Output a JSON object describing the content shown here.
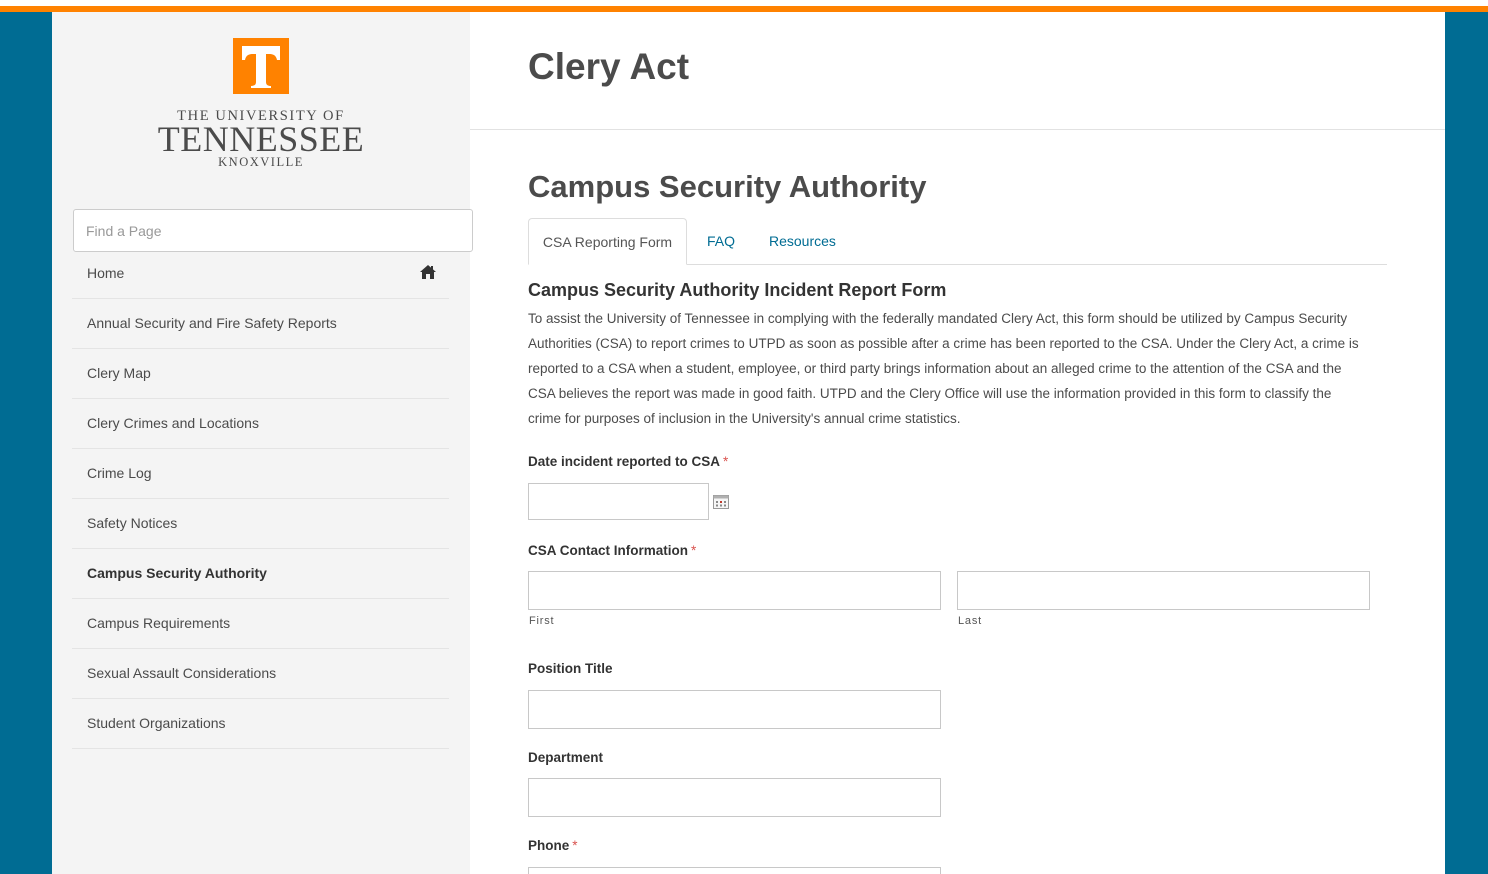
{
  "brand": {
    "logo_letter": "T",
    "line1": "THE UNIVERSITY OF",
    "line2": "TENNESSEE",
    "line3": "KNOXVILLE",
    "orange": "#ff8200",
    "blue": "#006c93"
  },
  "sidebar": {
    "search_placeholder": "Find a Page",
    "items": [
      {
        "label": "Home",
        "icon": "home-icon"
      },
      {
        "label": "Annual Security and Fire Safety Reports"
      },
      {
        "label": "Clery Map"
      },
      {
        "label": "Clery Crimes and Locations"
      },
      {
        "label": "Crime Log"
      },
      {
        "label": "Safety Notices"
      },
      {
        "label": "Campus Security Authority",
        "active": true
      },
      {
        "label": "Campus Requirements"
      },
      {
        "label": "Sexual Assault Considerations"
      },
      {
        "label": "Student Organizations"
      }
    ]
  },
  "main": {
    "page_title": "Clery Act",
    "section_title": "Campus Security Authority",
    "tabs": [
      {
        "label": "CSA Reporting Form",
        "active": true
      },
      {
        "label": "FAQ"
      },
      {
        "label": "Resources"
      }
    ],
    "form": {
      "heading": "Campus Security Authority Incident Report Form",
      "intro": "To assist the University of Tennessee in complying with the federally mandated Clery Act, this form should be utilized by Campus Security Authorities (CSA) to report crimes to UTPD as soon as possible after a crime has been reported to the CSA. Under the Clery Act, a crime is reported to a CSA when a student, employee, or third party brings information about an alleged crime to the attention of the CSA and the CSA believes the report was made in good faith. UTPD and the Clery Office will use the information provided in this form to classify the crime for purposes of inclusion in the University's annual crime statistics.",
      "fields": {
        "date_label": "Date incident reported to CSA",
        "contact_label": "CSA Contact Information",
        "first_sublabel": "First",
        "last_sublabel": "Last",
        "position_label": "Position Title",
        "department_label": "Department",
        "phone_label": "Phone",
        "required_marker": "*"
      }
    }
  }
}
